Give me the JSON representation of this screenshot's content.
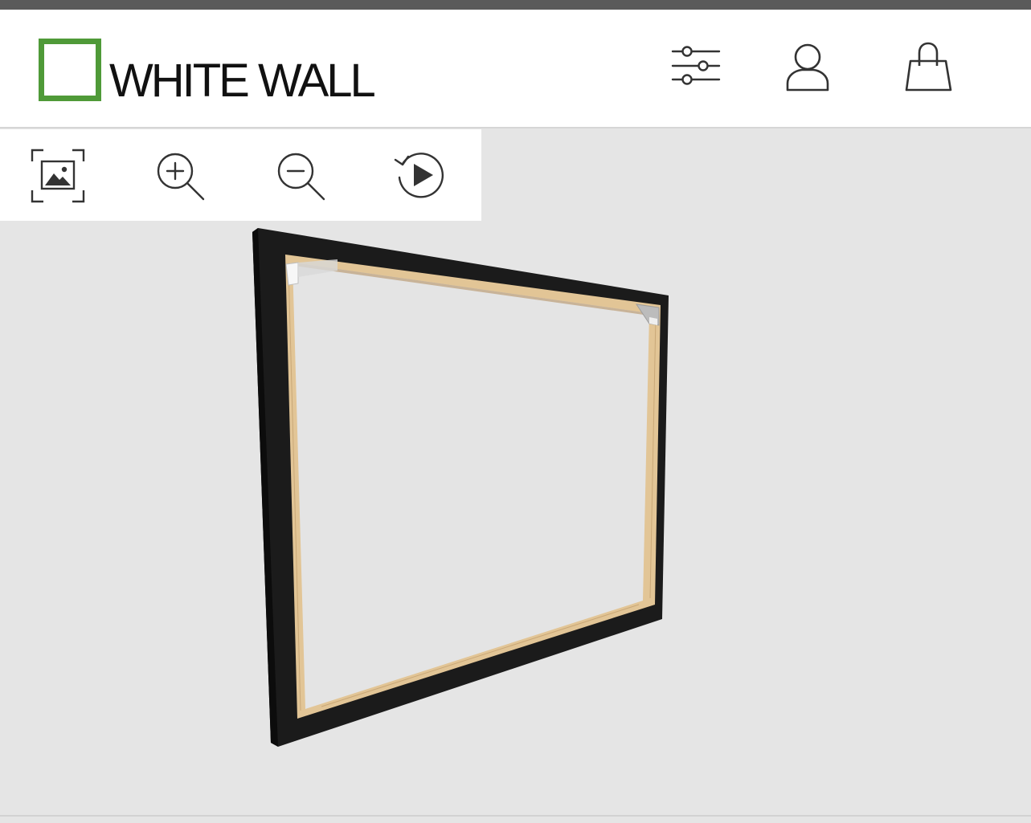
{
  "header": {
    "logo": {
      "text": "WHITE WALL",
      "accent_color": "#4f9a38"
    },
    "icons": [
      {
        "name": "filter-sliders-icon"
      },
      {
        "name": "user-account-icon"
      },
      {
        "name": "shopping-bag-icon"
      }
    ]
  },
  "toolbar": {
    "tools": [
      {
        "name": "fit-image-icon"
      },
      {
        "name": "zoom-in-icon"
      },
      {
        "name": "zoom-out-icon"
      },
      {
        "name": "rotate-play-icon"
      }
    ]
  },
  "viewer": {
    "frame_color": "#1a1a1a",
    "stretcher_color": "#e2c596",
    "background_color": "#e5e5e5"
  }
}
